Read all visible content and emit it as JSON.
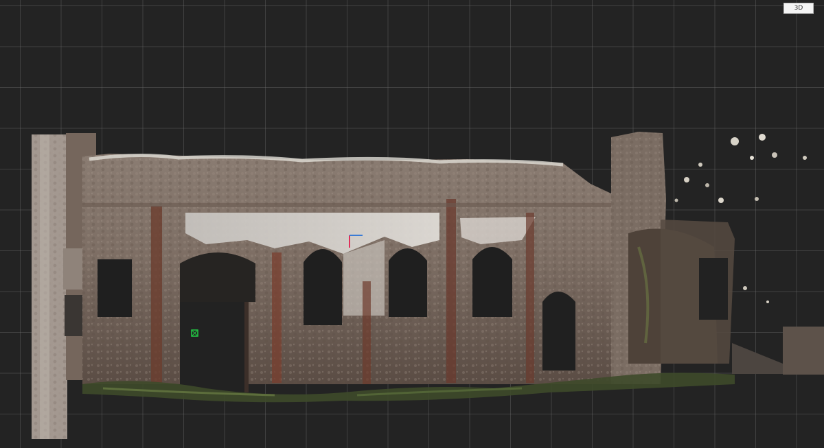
{
  "viewport": {
    "mode_label": "3D"
  },
  "scene": {
    "subject": "point-cloud-facade",
    "icons": [
      "axis-gizmo-icon",
      "pivot-marker-icon"
    ]
  },
  "colors": {
    "background": "#232323",
    "grid": "#5a5a5a",
    "axis_x": "#e0305a",
    "axis_y": "#3a7bd5",
    "pivot": "#22cc44"
  }
}
